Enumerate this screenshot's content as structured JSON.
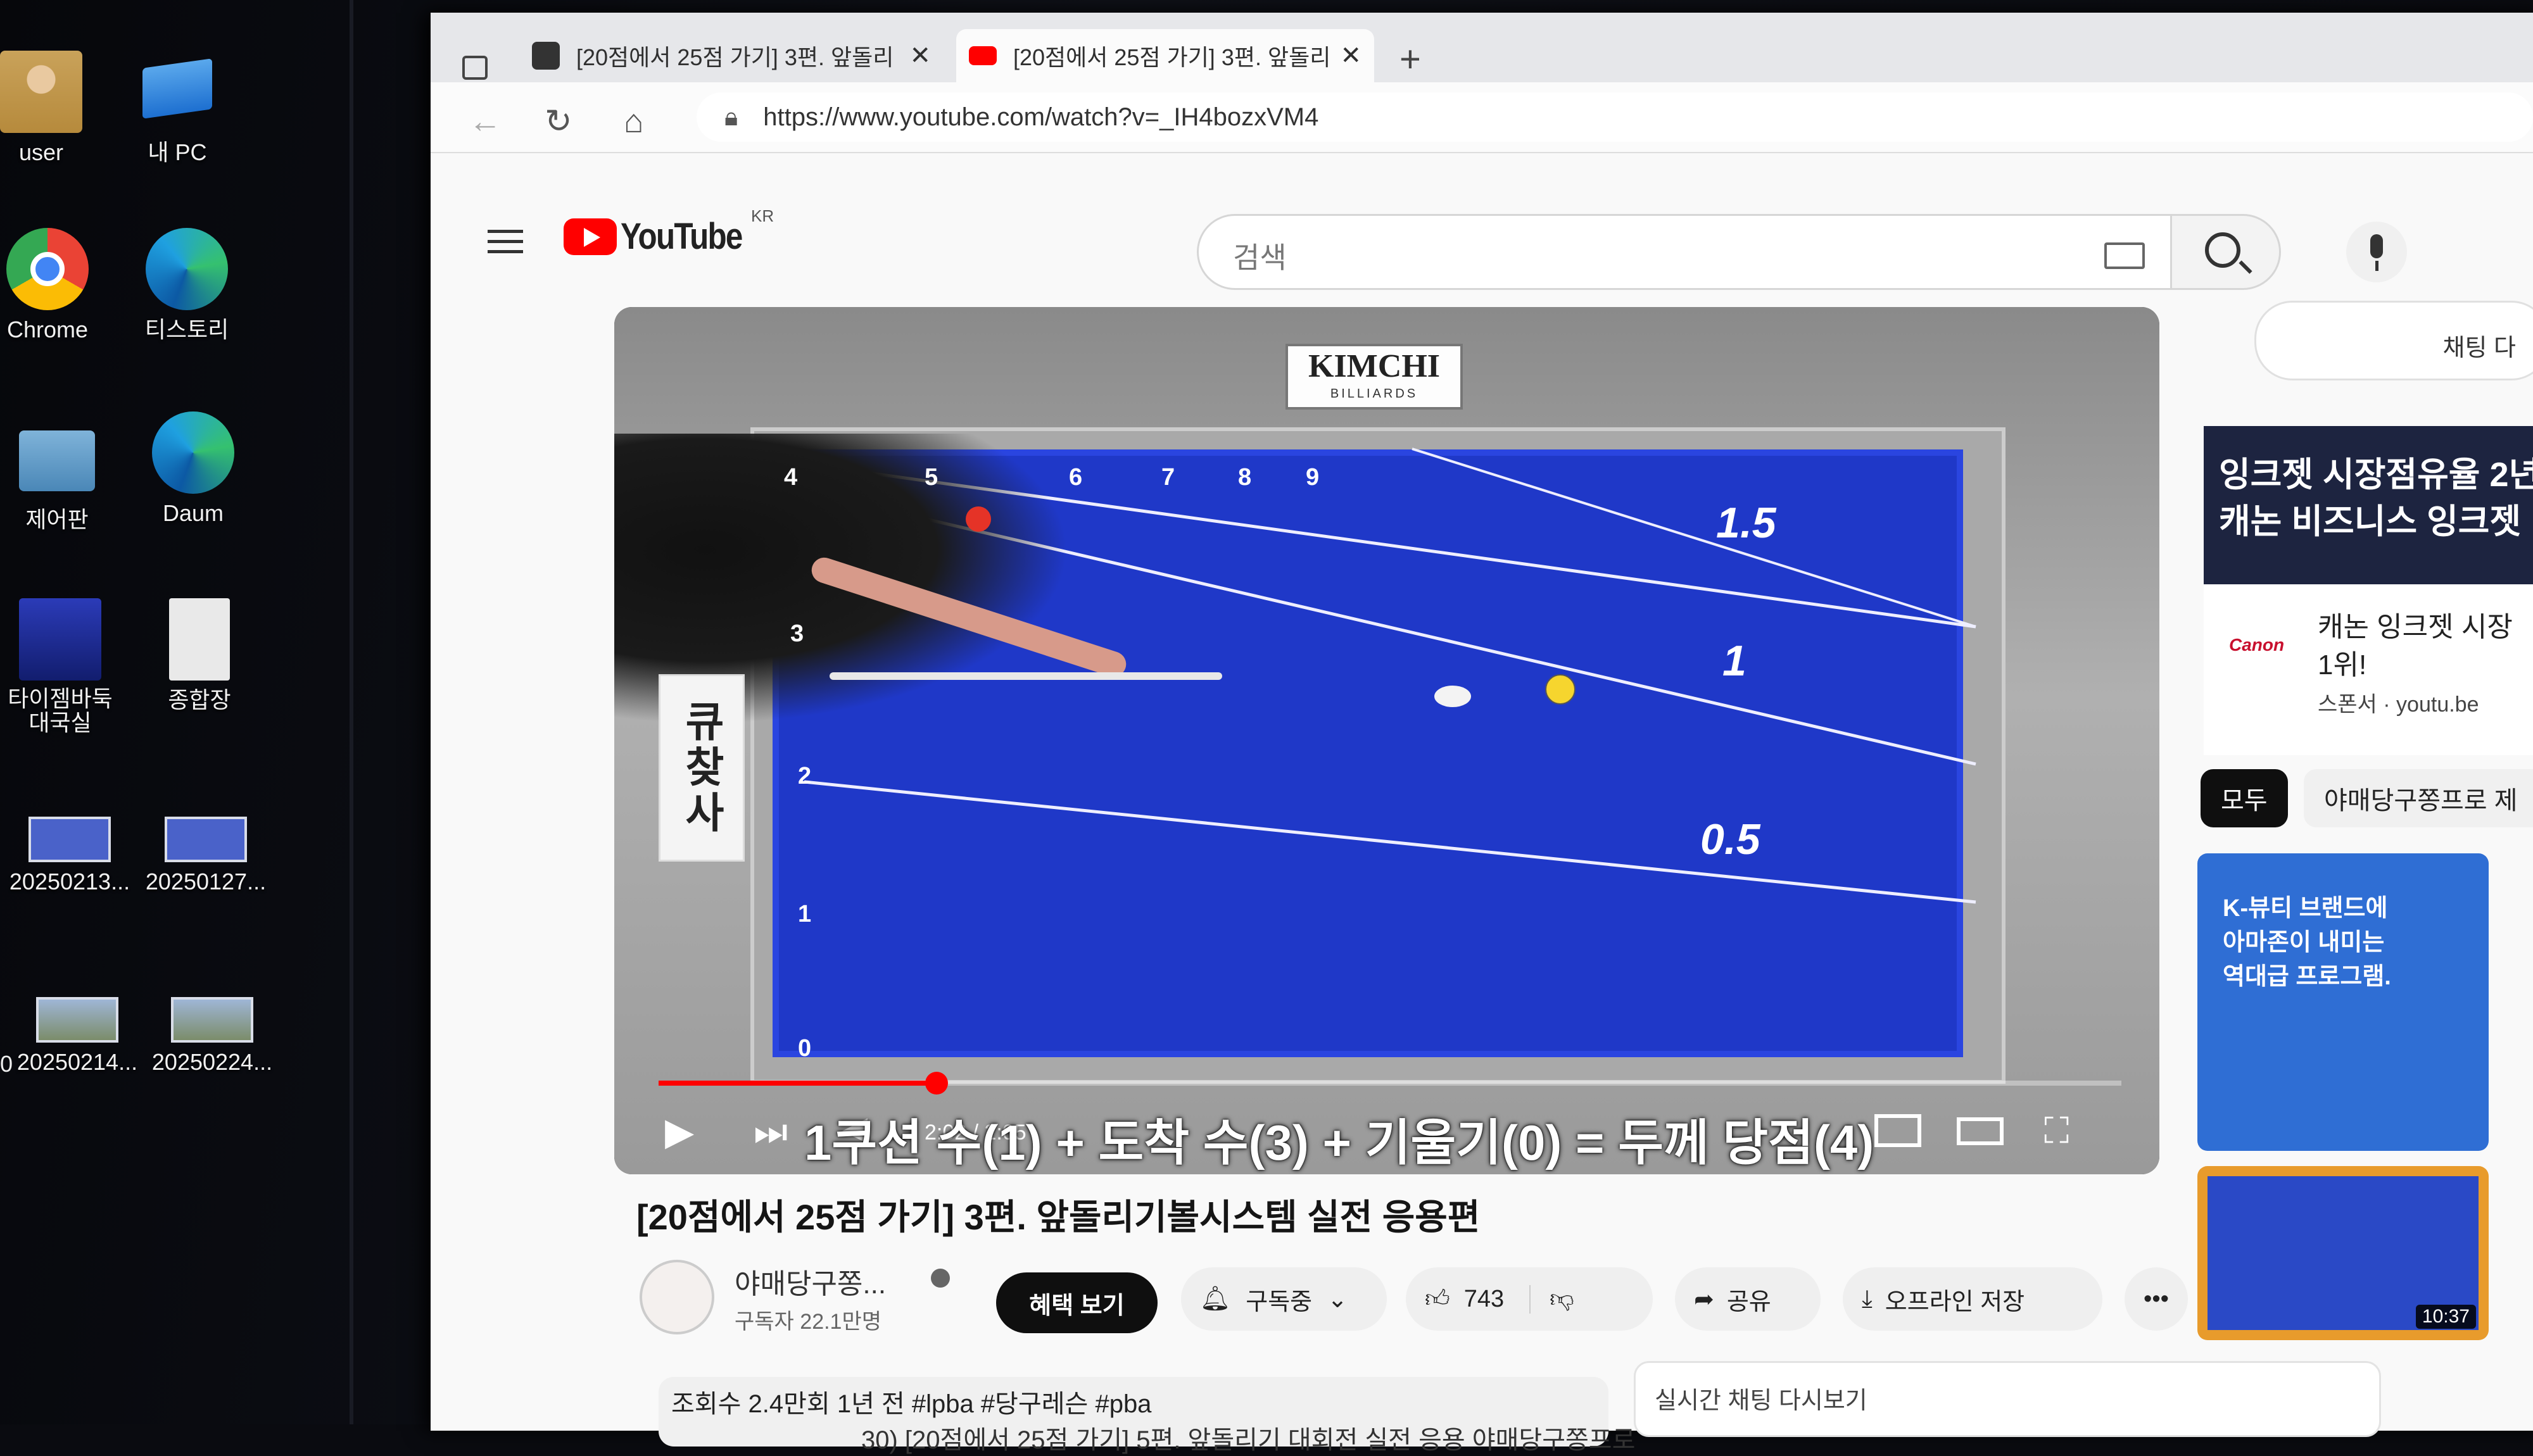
{
  "desktop": {
    "icons": [
      {
        "label": "user",
        "name": "user-folder-icon"
      },
      {
        "label": "내 PC",
        "name": "this-pc-icon"
      },
      {
        "label": "Chrome",
        "name": "chrome-icon"
      },
      {
        "label": "티스토리",
        "name": "edge-tistory-icon"
      },
      {
        "label": "제어판",
        "name": "control-panel-icon"
      },
      {
        "label": "Daum",
        "name": "edge-daum-icon"
      },
      {
        "label": "타이젬바둑 대국실",
        "name": "tygem-baduk-icon"
      },
      {
        "label": "종합장",
        "name": "document-icon"
      },
      {
        "label": "20250213...",
        "name": "image-file-icon"
      },
      {
        "label": "20250127...",
        "name": "image-file-icon"
      },
      {
        "label": "20250214...",
        "name": "image-file-icon"
      },
      {
        "label": "20250224...",
        "name": "image-file-icon"
      }
    ],
    "edge_fragment": "0"
  },
  "browser": {
    "tabs": [
      {
        "title": "[20점에서 25점 가기] 3편. 앞돌리",
        "favicon": "daum-d-icon",
        "active": false
      },
      {
        "title": "[20점에서 25점 가기] 3편. 앞돌리",
        "favicon": "youtube-icon",
        "active": true
      }
    ],
    "new_tab": "+",
    "url": "https://www.youtube.com/watch?v=_IH4bozxVM4"
  },
  "youtube": {
    "logo_text": "YouTube",
    "region": "KR",
    "search_placeholder": "검색",
    "player": {
      "brand": "KIMCHI",
      "brand_sub": "BILLIARDS",
      "top_diamonds": [
        "5",
        "6",
        "7",
        "8",
        "9"
      ],
      "left_diamonds": [
        "4",
        "3",
        "2",
        "1",
        "0"
      ],
      "system_labels": [
        "1.5",
        "1",
        "0.5"
      ],
      "badge": "큐찾사",
      "time": "2:02 / 2:05",
      "progress": 0.19,
      "subtitle": "1쿠션 수(1) + 도착 수(3) + 기울기(0) = 두께 당점(4)"
    },
    "video_title": "[20점에서 25점 가기] 3편. 앞돌리기볼시스템 실전 응용편",
    "channel": {
      "name": "야매당구쫑...",
      "subscribers": "구독자 22.1만명"
    },
    "actions": {
      "join": "혜택 보기",
      "subscribed": "구독중",
      "likes": "743",
      "share": "공유",
      "download": "오프라인 저장",
      "more": "•••"
    },
    "meta": "조회수 2.4만회  1년 전  #lpba #당구레슨 #pba",
    "live_chat_replay": "실시간 채팅 다시보기",
    "below_text": "30) [20점에서 25점 가기] 5편. 앞돌리기 대회전 실전 응용 야매당구쫑프로",
    "sidebar": {
      "chat_toggle": "채팅 다",
      "ad_banner": "잉크젯 시장점유율 2년\n캐논 비즈니스 잉크젯",
      "ad_brand": "Canon",
      "ad_title": "캐논 잉크젯 시장\n1위!",
      "ad_sponsor": "스폰서 · youtu.be",
      "chips": [
        "모두",
        "야매당구쫑프로 제"
      ],
      "thumb1": "K-뷰티 브랜드에\n아마존이 내미는\n역대급 프로그램.",
      "thumb2_duration": "10:37"
    }
  }
}
